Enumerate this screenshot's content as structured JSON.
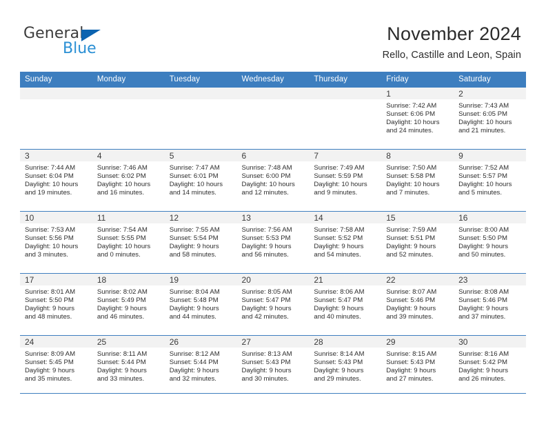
{
  "brand": {
    "name_part1": "General",
    "name_part2": "Blue",
    "triangle_icon": "triangle-icon",
    "colors": {
      "dark": "#3c3c3c",
      "blue": "#2a8fd4",
      "triangle": "#0c63b0"
    }
  },
  "header": {
    "title": "November 2024",
    "location": "Rello, Castille and Leon, Spain"
  },
  "calendar": {
    "accent_color": "#3d7ebf",
    "datebar_color": "#f2f2f2",
    "weekdays": [
      "Sunday",
      "Monday",
      "Tuesday",
      "Wednesday",
      "Thursday",
      "Friday",
      "Saturday"
    ],
    "weeks": [
      [
        {
          "day": ""
        },
        {
          "day": ""
        },
        {
          "day": ""
        },
        {
          "day": ""
        },
        {
          "day": ""
        },
        {
          "day": "1",
          "sunrise": "Sunrise: 7:42 AM",
          "sunset": "Sunset: 6:06 PM",
          "daylight1": "Daylight: 10 hours",
          "daylight2": "and 24 minutes."
        },
        {
          "day": "2",
          "sunrise": "Sunrise: 7:43 AM",
          "sunset": "Sunset: 6:05 PM",
          "daylight1": "Daylight: 10 hours",
          "daylight2": "and 21 minutes."
        }
      ],
      [
        {
          "day": "3",
          "sunrise": "Sunrise: 7:44 AM",
          "sunset": "Sunset: 6:04 PM",
          "daylight1": "Daylight: 10 hours",
          "daylight2": "and 19 minutes."
        },
        {
          "day": "4",
          "sunrise": "Sunrise: 7:46 AM",
          "sunset": "Sunset: 6:02 PM",
          "daylight1": "Daylight: 10 hours",
          "daylight2": "and 16 minutes."
        },
        {
          "day": "5",
          "sunrise": "Sunrise: 7:47 AM",
          "sunset": "Sunset: 6:01 PM",
          "daylight1": "Daylight: 10 hours",
          "daylight2": "and 14 minutes."
        },
        {
          "day": "6",
          "sunrise": "Sunrise: 7:48 AM",
          "sunset": "Sunset: 6:00 PM",
          "daylight1": "Daylight: 10 hours",
          "daylight2": "and 12 minutes."
        },
        {
          "day": "7",
          "sunrise": "Sunrise: 7:49 AM",
          "sunset": "Sunset: 5:59 PM",
          "daylight1": "Daylight: 10 hours",
          "daylight2": "and 9 minutes."
        },
        {
          "day": "8",
          "sunrise": "Sunrise: 7:50 AM",
          "sunset": "Sunset: 5:58 PM",
          "daylight1": "Daylight: 10 hours",
          "daylight2": "and 7 minutes."
        },
        {
          "day": "9",
          "sunrise": "Sunrise: 7:52 AM",
          "sunset": "Sunset: 5:57 PM",
          "daylight1": "Daylight: 10 hours",
          "daylight2": "and 5 minutes."
        }
      ],
      [
        {
          "day": "10",
          "sunrise": "Sunrise: 7:53 AM",
          "sunset": "Sunset: 5:56 PM",
          "daylight1": "Daylight: 10 hours",
          "daylight2": "and 3 minutes."
        },
        {
          "day": "11",
          "sunrise": "Sunrise: 7:54 AM",
          "sunset": "Sunset: 5:55 PM",
          "daylight1": "Daylight: 10 hours",
          "daylight2": "and 0 minutes."
        },
        {
          "day": "12",
          "sunrise": "Sunrise: 7:55 AM",
          "sunset": "Sunset: 5:54 PM",
          "daylight1": "Daylight: 9 hours",
          "daylight2": "and 58 minutes."
        },
        {
          "day": "13",
          "sunrise": "Sunrise: 7:56 AM",
          "sunset": "Sunset: 5:53 PM",
          "daylight1": "Daylight: 9 hours",
          "daylight2": "and 56 minutes."
        },
        {
          "day": "14",
          "sunrise": "Sunrise: 7:58 AM",
          "sunset": "Sunset: 5:52 PM",
          "daylight1": "Daylight: 9 hours",
          "daylight2": "and 54 minutes."
        },
        {
          "day": "15",
          "sunrise": "Sunrise: 7:59 AM",
          "sunset": "Sunset: 5:51 PM",
          "daylight1": "Daylight: 9 hours",
          "daylight2": "and 52 minutes."
        },
        {
          "day": "16",
          "sunrise": "Sunrise: 8:00 AM",
          "sunset": "Sunset: 5:50 PM",
          "daylight1": "Daylight: 9 hours",
          "daylight2": "and 50 minutes."
        }
      ],
      [
        {
          "day": "17",
          "sunrise": "Sunrise: 8:01 AM",
          "sunset": "Sunset: 5:50 PM",
          "daylight1": "Daylight: 9 hours",
          "daylight2": "and 48 minutes."
        },
        {
          "day": "18",
          "sunrise": "Sunrise: 8:02 AM",
          "sunset": "Sunset: 5:49 PM",
          "daylight1": "Daylight: 9 hours",
          "daylight2": "and 46 minutes."
        },
        {
          "day": "19",
          "sunrise": "Sunrise: 8:04 AM",
          "sunset": "Sunset: 5:48 PM",
          "daylight1": "Daylight: 9 hours",
          "daylight2": "and 44 minutes."
        },
        {
          "day": "20",
          "sunrise": "Sunrise: 8:05 AM",
          "sunset": "Sunset: 5:47 PM",
          "daylight1": "Daylight: 9 hours",
          "daylight2": "and 42 minutes."
        },
        {
          "day": "21",
          "sunrise": "Sunrise: 8:06 AM",
          "sunset": "Sunset: 5:47 PM",
          "daylight1": "Daylight: 9 hours",
          "daylight2": "and 40 minutes."
        },
        {
          "day": "22",
          "sunrise": "Sunrise: 8:07 AM",
          "sunset": "Sunset: 5:46 PM",
          "daylight1": "Daylight: 9 hours",
          "daylight2": "and 39 minutes."
        },
        {
          "day": "23",
          "sunrise": "Sunrise: 8:08 AM",
          "sunset": "Sunset: 5:46 PM",
          "daylight1": "Daylight: 9 hours",
          "daylight2": "and 37 minutes."
        }
      ],
      [
        {
          "day": "24",
          "sunrise": "Sunrise: 8:09 AM",
          "sunset": "Sunset: 5:45 PM",
          "daylight1": "Daylight: 9 hours",
          "daylight2": "and 35 minutes."
        },
        {
          "day": "25",
          "sunrise": "Sunrise: 8:11 AM",
          "sunset": "Sunset: 5:44 PM",
          "daylight1": "Daylight: 9 hours",
          "daylight2": "and 33 minutes."
        },
        {
          "day": "26",
          "sunrise": "Sunrise: 8:12 AM",
          "sunset": "Sunset: 5:44 PM",
          "daylight1": "Daylight: 9 hours",
          "daylight2": "and 32 minutes."
        },
        {
          "day": "27",
          "sunrise": "Sunrise: 8:13 AM",
          "sunset": "Sunset: 5:43 PM",
          "daylight1": "Daylight: 9 hours",
          "daylight2": "and 30 minutes."
        },
        {
          "day": "28",
          "sunrise": "Sunrise: 8:14 AM",
          "sunset": "Sunset: 5:43 PM",
          "daylight1": "Daylight: 9 hours",
          "daylight2": "and 29 minutes."
        },
        {
          "day": "29",
          "sunrise": "Sunrise: 8:15 AM",
          "sunset": "Sunset: 5:43 PM",
          "daylight1": "Daylight: 9 hours",
          "daylight2": "and 27 minutes."
        },
        {
          "day": "30",
          "sunrise": "Sunrise: 8:16 AM",
          "sunset": "Sunset: 5:42 PM",
          "daylight1": "Daylight: 9 hours",
          "daylight2": "and 26 minutes."
        }
      ]
    ]
  }
}
